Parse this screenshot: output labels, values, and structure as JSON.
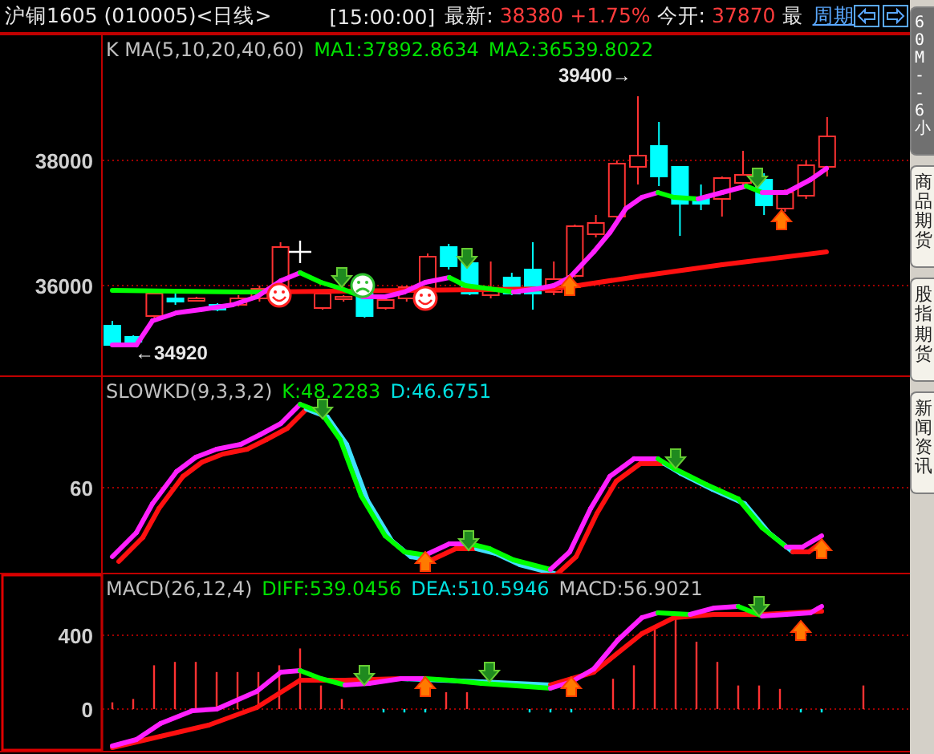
{
  "header": {
    "title": "沪铜1605 (010005)<日线>",
    "time": "[15:00:00]",
    "quote": [
      {
        "kind": "label",
        "text": "最新:"
      },
      {
        "kind": "value",
        "text": "38380"
      },
      {
        "kind": "value",
        "text": "+1.75%"
      },
      {
        "kind": "label",
        "text": "今开:"
      },
      {
        "kind": "value",
        "text": "37870"
      },
      {
        "kind": "label",
        "text": "最"
      }
    ],
    "period_link": "周期"
  },
  "panels": [
    {
      "kind": "price",
      "selected": false,
      "legend": [
        {
          "text": "K  MA(5,10,20,40,60)",
          "color": "#c0c0c0"
        },
        {
          "text": "MA1:37892.8634",
          "color": "#00e000"
        },
        {
          "text": "MA2:36539.8022",
          "color": "#00e000"
        }
      ],
      "y_labels": [
        "38000",
        "36000"
      ],
      "high_label": "39400→",
      "low_label": "←34920"
    },
    {
      "kind": "kd",
      "selected": false,
      "legend": [
        {
          "text": "SLOWKD(9,3,3,2)",
          "color": "#c0c0c0"
        },
        {
          "text": "K:48.2283",
          "color": "#00e000"
        },
        {
          "text": "D:46.6751",
          "color": "#00e0e0"
        }
      ],
      "y_labels": [
        "60"
      ]
    },
    {
      "kind": "macd",
      "selected": true,
      "legend": [
        {
          "text": "MACD(26,12,4)",
          "color": "#c0c0c0"
        },
        {
          "text": "DIFF:539.0456",
          "color": "#00e000"
        },
        {
          "text": "DEA:510.5946",
          "color": "#00e0e0"
        },
        {
          "text": "MACD:56.9021",
          "color": "#c0c0c0"
        }
      ],
      "y_labels": [
        "400",
        "0"
      ]
    }
  ],
  "side_tabs": [
    {
      "label": "60M--6小",
      "selected": true
    },
    {
      "label": "商品期货",
      "selected": false
    },
    {
      "label": "股指期货",
      "selected": false
    },
    {
      "label": "新闻资讯",
      "selected": false
    }
  ]
}
